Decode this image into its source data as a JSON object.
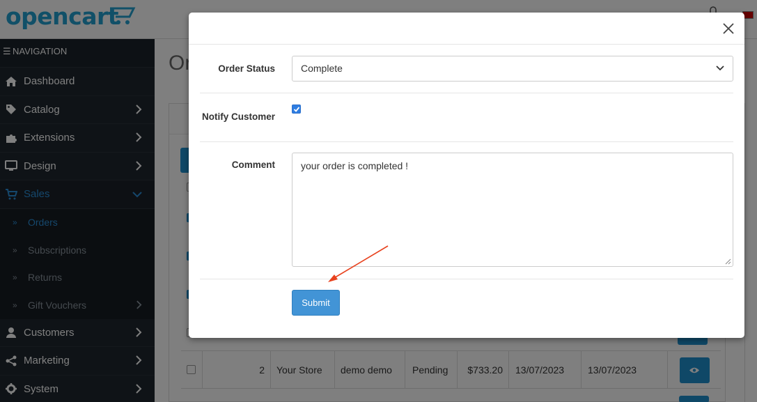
{
  "header": {
    "logo_text": "opencart"
  },
  "sidebar": {
    "heading": "NAVIGATION",
    "items": [
      {
        "label": "Dashboard",
        "icon": "home-icon"
      },
      {
        "label": "Catalog",
        "icon": "tag-icon"
      },
      {
        "label": "Extensions",
        "icon": "puzzle-icon"
      },
      {
        "label": "Design",
        "icon": "monitor-icon"
      },
      {
        "label": "Sales",
        "icon": "shopping-cart-icon",
        "active": true
      },
      {
        "label": "Customers",
        "icon": "user-icon"
      },
      {
        "label": "Marketing",
        "icon": "share-icon"
      },
      {
        "label": "System",
        "icon": "gear-icon"
      }
    ],
    "sales_sub": [
      {
        "label": "Orders",
        "active": true
      },
      {
        "label": "Subscriptions"
      },
      {
        "label": "Returns"
      },
      {
        "label": "Gift Vouchers"
      }
    ]
  },
  "page": {
    "title": "Or",
    "row": {
      "order_id": "2",
      "store": "Your Store",
      "customer": "demo demo",
      "status": "Pending",
      "total": "$733.20",
      "date_added": "13/07/2023",
      "date_modified": "13/07/2023"
    }
  },
  "modal": {
    "order_status_label": "Order Status",
    "order_status_value": "Complete",
    "notify_label": "Notify Customer",
    "notify_checked": true,
    "comment_label": "Comment",
    "comment_value": "your order is completed !",
    "submit_label": "Submit"
  },
  "colors": {
    "brand": "#23a1d1",
    "sidebar_bg": "#1b222a",
    "active_nav": "#2a8fd8",
    "primary_button": "#4294d6",
    "arrow": "#e8421e"
  }
}
